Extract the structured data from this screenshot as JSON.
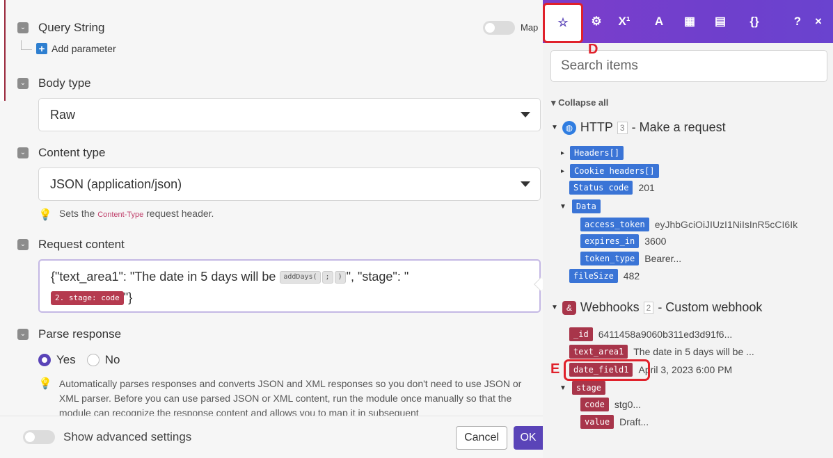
{
  "form": {
    "query_string_label": "Query String",
    "map_label": "Map",
    "add_parameter": "Add parameter",
    "body_type_label": "Body type",
    "body_type_value": "Raw",
    "content_type_label": "Content type",
    "content_type_value": "JSON (application/json)",
    "content_type_hint_prefix": "Sets the",
    "content_type_hint_code": "Content-Type",
    "content_type_hint_suffix": "request header.",
    "request_content_label": "Request content",
    "request_text_1": "{\"text_area1\": \"The date in 5 days will be",
    "fn_add_days": "addDays(",
    "fn_sep": ";",
    "fn_close": ")",
    "request_text_2": "\", \"stage\": \"",
    "stage_pill": "2. stage: code",
    "request_text_3": "\"}",
    "parse_response_label": "Parse response",
    "yes_label": "Yes",
    "no_label": "No",
    "parse_hint": "Automatically parses responses and converts JSON and XML responses so you don't need to use JSON or XML parser. Before you can use parsed JSON or XML content, run the module once manually so that the module can recognize the response content and allows you to map it in subsequent",
    "show_advanced": "Show advanced settings",
    "cancel": "Cancel",
    "ok": "OK"
  },
  "panel": {
    "tabs": [
      {
        "icon": "star-icon",
        "glyph": "☆"
      },
      {
        "icon": "gear-icon",
        "glyph": "⚙"
      },
      {
        "icon": "superscript-icon",
        "glyph": "X¹"
      },
      {
        "icon": "text-icon",
        "glyph": "A"
      },
      {
        "icon": "calendar-icon",
        "glyph": "▦"
      },
      {
        "icon": "table-icon",
        "glyph": "▤"
      },
      {
        "icon": "braces-icon",
        "glyph": "{}"
      },
      {
        "icon": "help-icon",
        "glyph": "?"
      },
      {
        "icon": "close-icon",
        "glyph": "×"
      }
    ],
    "label_d": "D",
    "label_e": "E",
    "search_placeholder": "Search items",
    "collapse_all": "Collapse all",
    "http_module": {
      "name": "HTTP",
      "count": "3",
      "desc": "- Make a request"
    },
    "http_items": {
      "headers": "Headers[]",
      "cookie_headers": "Cookie headers[]",
      "status_code": "Status code",
      "status_code_value": "201",
      "data": "Data",
      "access_token": "access_token",
      "access_token_value": "eyJhbGciOiJIUzI1NiIsInR5cCI6Ik",
      "expires_in": "expires_in",
      "expires_in_value": "3600",
      "token_type": "token_type",
      "token_type_value": "Bearer...",
      "file_size": "fileSize",
      "file_size_value": "482"
    },
    "webhook_module": {
      "name": "Webhooks",
      "count": "2",
      "desc": "- Custom webhook"
    },
    "webhook_items": {
      "id": "_id",
      "id_value": "6411458a9060b311ed3d91f6...",
      "text_area1": "text_area1",
      "text_area1_value": "The date in 5 days will be ...",
      "date_field1": "date_field1",
      "date_field1_value": "April 3, 2023 6:00 PM",
      "stage": "stage",
      "code": "code",
      "code_value": "stg0...",
      "value": "value",
      "value_value": "Draft..."
    }
  },
  "colors": {
    "accent": "#5a44b8",
    "tabbar": "#7c3ecb",
    "http_tag": "#3a74d6",
    "webhook_tag": "#a8354a",
    "annotation": "#e0212b"
  }
}
